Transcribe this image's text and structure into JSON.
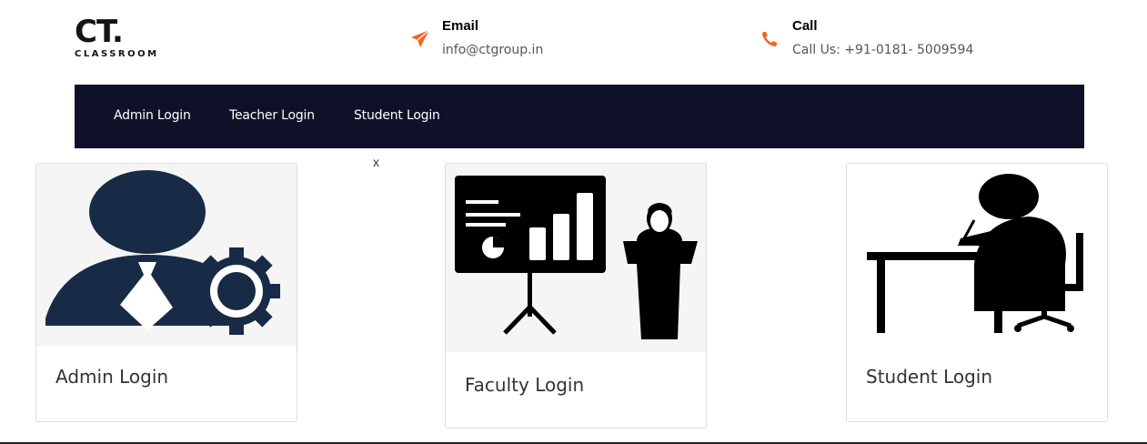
{
  "logo": {
    "main": "CT.",
    "sub": "CLASSROOM"
  },
  "contacts": {
    "email": {
      "title": "Email",
      "value": "info@ctgroup.in",
      "icon": "paper-plane-icon"
    },
    "call": {
      "title": "Call",
      "value": "Call Us: +91-0181- 5009594",
      "icon": "phone-icon"
    }
  },
  "nav": {
    "items": [
      {
        "label": "Admin Login"
      },
      {
        "label": "Teacher Login"
      },
      {
        "label": "Student Login"
      }
    ]
  },
  "close_label": "x",
  "cards": [
    {
      "title": "Admin Login",
      "icon": "admin-gear-icon"
    },
    {
      "title": "Faculty Login",
      "icon": "presentation-podium-icon"
    },
    {
      "title": "Student Login",
      "icon": "student-desk-icon"
    }
  ],
  "colors": {
    "accent": "#f26522",
    "navbar": "#0e1128",
    "admin_icon": "#172b47"
  }
}
